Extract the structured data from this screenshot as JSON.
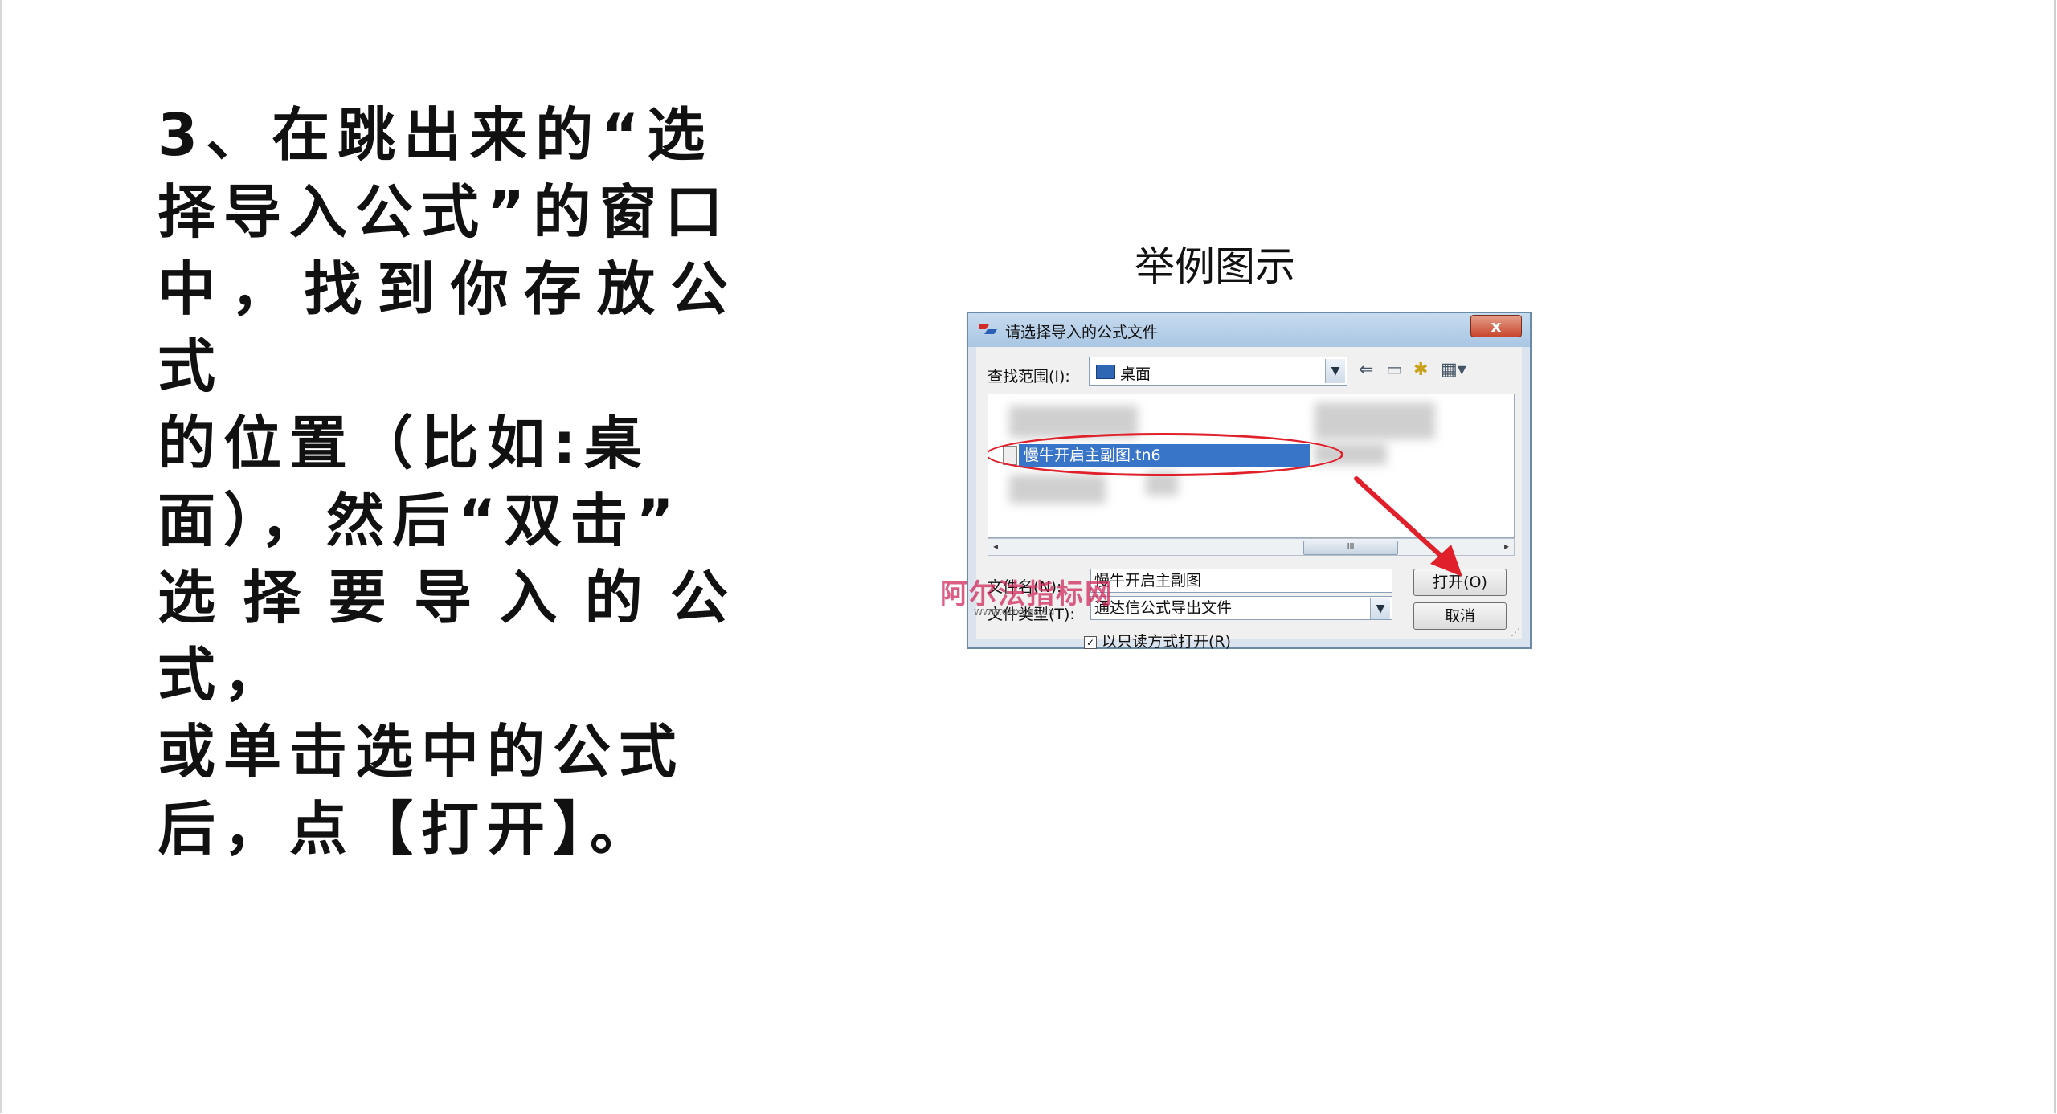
{
  "instruction": {
    "lines": [
      "3、在跳出来的“选",
      "择导入公式”的窗口",
      "中，找到你存放公式",
      "的位置（比如:桌",
      "面），然后“双击”",
      "选择要导入的公式，",
      "或单击选中的公式",
      "后，点【打开】。"
    ]
  },
  "caption": "举例图示",
  "dialog": {
    "title": "请选择导入的公式文件",
    "close_label": "x",
    "look_in_label": "查找范围(I):",
    "look_in_value": "桌面",
    "selected_file": "慢牛开启主副图.tn6",
    "file_name_label": "文件名(N):",
    "file_name_value": "慢牛开启主副图",
    "file_type_label": "文件类型(T):",
    "file_type_value": "通达信公式导出文件",
    "open_button": "打开(O)",
    "cancel_button": "取消",
    "readonly_label": "以只读方式打开(R)",
    "scroll_thumb": "III"
  },
  "watermark": {
    "text": "阿尔法指标网",
    "sub": "WWW.GUXUE8.CN"
  },
  "colors": {
    "highlight_ellipse": "#e0202a",
    "selection": "#3874c8"
  }
}
